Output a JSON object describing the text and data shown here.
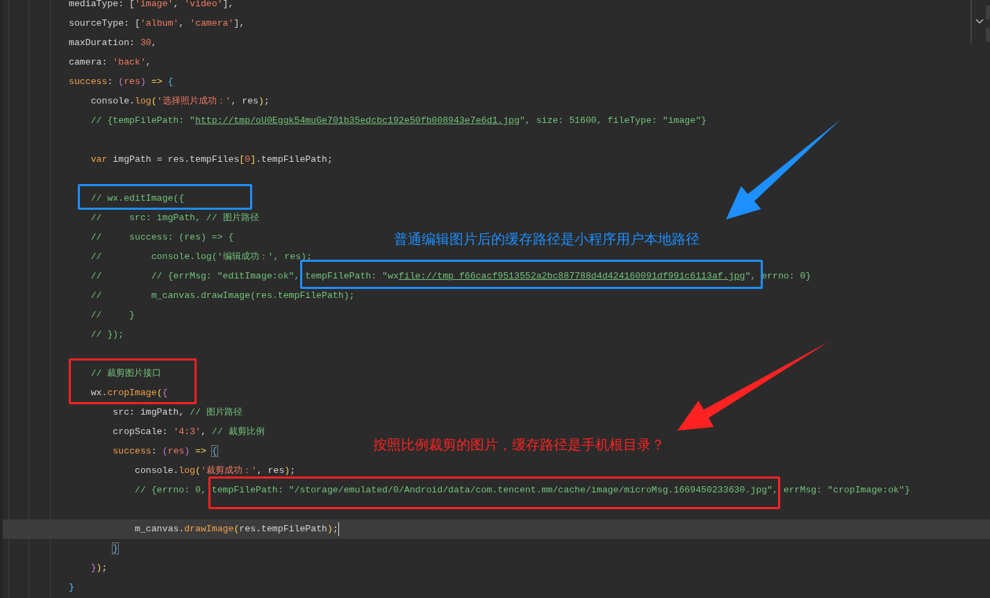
{
  "editor": {
    "lines": [
      {
        "current": false,
        "tokens": [
          {
            "text": "mediaType: [",
            "kind": "plain"
          },
          {
            "text": "'image'",
            "kind": "string"
          },
          {
            "text": ", ",
            "kind": "plain"
          },
          {
            "text": "'video'",
            "kind": "string"
          },
          {
            "text": "],",
            "kind": "plain"
          }
        ]
      },
      {
        "current": false,
        "tokens": [
          {
            "text": "sourceType: [",
            "kind": "plain"
          },
          {
            "text": "'album'",
            "kind": "string"
          },
          {
            "text": ", ",
            "kind": "plain"
          },
          {
            "text": "'camera'",
            "kind": "string"
          },
          {
            "text": "],",
            "kind": "plain"
          }
        ]
      },
      {
        "current": false,
        "tokens": [
          {
            "text": "maxDuration: ",
            "kind": "plain"
          },
          {
            "text": "30",
            "kind": "number"
          },
          {
            "text": ",",
            "kind": "plain"
          }
        ]
      },
      {
        "current": false,
        "tokens": [
          {
            "text": "camera: ",
            "kind": "plain"
          },
          {
            "text": "'back'",
            "kind": "string"
          },
          {
            "text": ",",
            "kind": "plain"
          }
        ]
      },
      {
        "current": false,
        "tokens": [
          {
            "text": "success",
            "kind": "keyword"
          },
          {
            "text": ": ",
            "kind": "plain"
          },
          {
            "text": "(",
            "kind": "purple"
          },
          {
            "text": "res",
            "kind": "param"
          },
          {
            "text": ")",
            "kind": "purple"
          },
          {
            "text": " => ",
            "kind": "yellow"
          },
          {
            "text": "{",
            "kind": "blue"
          }
        ]
      },
      {
        "current": false,
        "tokens": [
          {
            "text": "    console.",
            "kind": "plain"
          },
          {
            "text": "log",
            "kind": "func"
          },
          {
            "text": "(",
            "kind": "yellow"
          },
          {
            "text": "'选择照片成功：'",
            "kind": "string"
          },
          {
            "text": ", res",
            "kind": "plain"
          },
          {
            "text": ")",
            "kind": "yellow"
          },
          {
            "text": ";",
            "kind": "plain"
          }
        ]
      },
      {
        "current": false,
        "tokens": [
          {
            "text": "    // {tempFilePath: \"",
            "kind": "comment"
          },
          {
            "text": "http://tmp/oU0Eggk54muGe701b35edcbc192e50fb008943e7e6d1.jpg",
            "kind": "link"
          },
          {
            "text": "\", size: 51600, fileType: \"image\"}",
            "kind": "comment"
          }
        ]
      },
      {
        "current": false
      },
      {
        "current": false,
        "tokens": [
          {
            "text": "    var",
            "kind": "keyword"
          },
          {
            "text": " imgPath = res.tempFiles",
            "kind": "plain"
          },
          {
            "text": "[",
            "kind": "yellow"
          },
          {
            "text": "0",
            "kind": "number"
          },
          {
            "text": "]",
            "kind": "yellow"
          },
          {
            "text": ".tempFilePath;",
            "kind": "plain"
          }
        ]
      },
      {
        "current": false
      },
      {
        "current": false,
        "tokens": [
          {
            "text": "    // wx.editImage({",
            "kind": "comment"
          }
        ]
      },
      {
        "current": false,
        "tokens": [
          {
            "text": "    //     src: imgPath, // 图片路径",
            "kind": "comment"
          }
        ]
      },
      {
        "current": false,
        "tokens": [
          {
            "text": "    //     success: (res) => {",
            "kind": "comment"
          }
        ]
      },
      {
        "current": false,
        "tokens": [
          {
            "text": "    //         console.log('编辑成功：', res);",
            "kind": "comment"
          }
        ]
      },
      {
        "current": false,
        "tokens": [
          {
            "text": "    //         // {errMsg: \"editImage:ok\", tempFilePath: \"wx",
            "kind": "comment"
          },
          {
            "text": "file://tmp_f66cacf9513552a2bc887788d4d424160091df991c6113af.jpg",
            "kind": "link"
          },
          {
            "text": "\", errno: 0}",
            "kind": "comment"
          }
        ]
      },
      {
        "current": false,
        "tokens": [
          {
            "text": "    //         m_canvas.drawImage(res.tempFilePath);",
            "kind": "comment"
          }
        ]
      },
      {
        "current": false,
        "tokens": [
          {
            "text": "    //     }",
            "kind": "comment"
          }
        ]
      },
      {
        "current": false,
        "tokens": [
          {
            "text": "    // });",
            "kind": "comment"
          }
        ]
      },
      {
        "current": false
      },
      {
        "current": false,
        "tokens": [
          {
            "text": "    // 裁剪图片接口",
            "kind": "comment"
          }
        ]
      },
      {
        "current": false,
        "tokens": [
          {
            "text": "    wx.",
            "kind": "plain"
          },
          {
            "text": "cropImage",
            "kind": "func"
          },
          {
            "text": "(",
            "kind": "yellow"
          },
          {
            "text": "{",
            "kind": "purple"
          }
        ]
      },
      {
        "current": false,
        "tokens": [
          {
            "text": "        src: imgPath, ",
            "kind": "plain"
          },
          {
            "text": "// 图片路径",
            "kind": "comment"
          }
        ]
      },
      {
        "current": false,
        "tokens": [
          {
            "text": "        cropScale: ",
            "kind": "plain"
          },
          {
            "text": "'4:3'",
            "kind": "string"
          },
          {
            "text": ", ",
            "kind": "plain"
          },
          {
            "text": "// 裁剪比例",
            "kind": "comment"
          }
        ]
      },
      {
        "current": false,
        "tokens": [
          {
            "text": "        success",
            "kind": "keyword"
          },
          {
            "text": ": ",
            "kind": "plain"
          },
          {
            "text": "(",
            "kind": "purple"
          },
          {
            "text": "res",
            "kind": "param"
          },
          {
            "text": ")",
            "kind": "purple"
          },
          {
            "text": " => ",
            "kind": "yellow"
          },
          {
            "text": "{",
            "kind": "match"
          }
        ]
      },
      {
        "current": false,
        "tokens": [
          {
            "text": "            console.",
            "kind": "plain"
          },
          {
            "text": "log",
            "kind": "func"
          },
          {
            "text": "(",
            "kind": "yellow"
          },
          {
            "text": "'裁剪成功：'",
            "kind": "string"
          },
          {
            "text": ", res",
            "kind": "plain"
          },
          {
            "text": ")",
            "kind": "yellow"
          },
          {
            "text": ";",
            "kind": "plain"
          }
        ]
      },
      {
        "current": false,
        "tokens": [
          {
            "text": "            // {errno: 0, tempFilePath: \"/storage/emulated/0/Android/data/com.tencent.mm/cache/image/microMsg.1669450233630.jpg\", errMsg: \"cropImage:ok\"}",
            "kind": "comment"
          }
        ]
      },
      {
        "current": false
      },
      {
        "current": true,
        "tokens": [
          {
            "text": "            m_canvas.",
            "kind": "plain"
          },
          {
            "text": "drawImage",
            "kind": "func"
          },
          {
            "text": "(",
            "kind": "yellow"
          },
          {
            "text": "res.tempFilePath",
            "kind": "plain"
          },
          {
            "text": ")",
            "kind": "yellow"
          },
          {
            "text": ";",
            "kind": "plain"
          }
        ]
      },
      {
        "current": false,
        "tokens": [
          {
            "text": "        }",
            "kind": "match"
          }
        ]
      },
      {
        "current": false,
        "tokens": [
          {
            "text": "    }",
            "kind": "purple"
          },
          {
            "text": ")",
            "kind": "yellow"
          },
          {
            "text": ";",
            "kind": "plain"
          }
        ]
      },
      {
        "current": false,
        "tokens": [
          {
            "text": "}",
            "kind": "blue"
          }
        ]
      }
    ]
  },
  "annotations": [
    {
      "kind": "box",
      "color": "#1e8fff"
    },
    {
      "kind": "box",
      "color": "#1e8fff"
    },
    {
      "kind": "arrow",
      "color": "#1e8fff"
    },
    {
      "kind": "note",
      "color": "#1e8fff",
      "text": "普通编辑图片后的缓存路径是小程序用户本地路径"
    },
    {
      "kind": "box",
      "color": "#ff2222"
    },
    {
      "kind": "box",
      "color": "#ff2222"
    },
    {
      "kind": "arrow",
      "color": "#ff2222"
    },
    {
      "kind": "note",
      "color": "#ff2222",
      "text": "按照比例裁剪的图片，缓存路径是手机根目录？"
    }
  ]
}
